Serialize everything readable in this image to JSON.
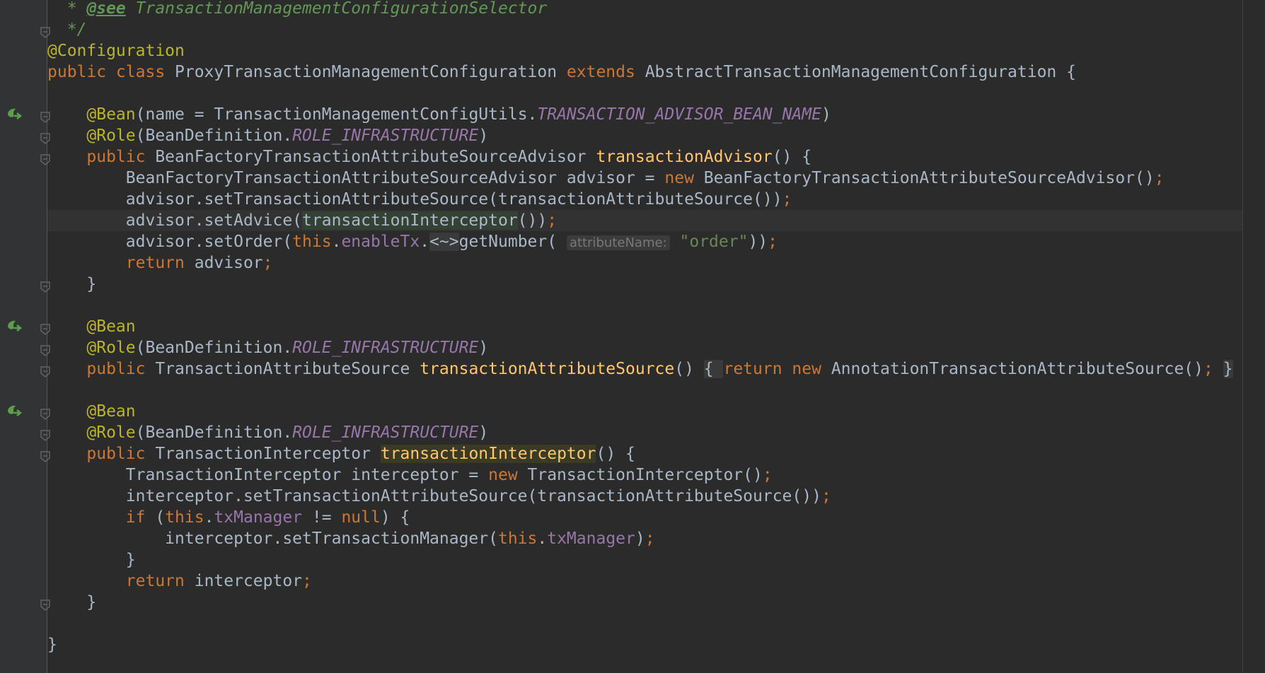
{
  "editor": {
    "lines": [
      {
        "tokens": [
          [
            "cmt",
            "  * "
          ],
          [
            "tagname",
            "@see"
          ],
          [
            "cmt",
            " TransactionManagementConfigurationSelector"
          ]
        ]
      },
      {
        "tokens": [
          [
            "cmt",
            "  */"
          ]
        ]
      },
      {
        "tokens": [
          [
            "ann",
            "@Configuration"
          ]
        ]
      },
      {
        "tokens": [
          [
            "kw",
            "public class "
          ],
          [
            "p",
            "ProxyTransactionManagementConfiguration "
          ],
          [
            "kw",
            "extends "
          ],
          [
            "p",
            "AbstractTransactionManagementConfiguration {"
          ]
        ]
      },
      {
        "tokens": []
      },
      {
        "tokens": [
          [
            "p",
            "    "
          ],
          [
            "ann",
            "@Bean"
          ],
          [
            "p",
            "("
          ],
          [
            "pname",
            "name"
          ],
          [
            "p",
            " = TransactionManagementConfigUtils."
          ],
          [
            "cst",
            "TRANSACTION_ADVISOR_BEAN_NAME"
          ],
          [
            "p",
            ")"
          ]
        ]
      },
      {
        "tokens": [
          [
            "p",
            "    "
          ],
          [
            "ann",
            "@Role"
          ],
          [
            "p",
            "(BeanDefinition."
          ],
          [
            "cst",
            "ROLE_INFRASTRUCTURE"
          ],
          [
            "p",
            ")"
          ]
        ]
      },
      {
        "tokens": [
          [
            "p",
            "    "
          ],
          [
            "kw",
            "public "
          ],
          [
            "p",
            "BeanFactoryTransactionAttributeSourceAdvisor "
          ],
          [
            "mdecl",
            "transactionAdvisor"
          ],
          [
            "p",
            "() {"
          ]
        ]
      },
      {
        "tokens": [
          [
            "p",
            "        BeanFactoryTransactionAttributeSourceAdvisor advisor = "
          ],
          [
            "kw",
            "new "
          ],
          [
            "p",
            "BeanFactoryTransactionAttributeSourceAdvisor()"
          ],
          [
            "semi",
            ";"
          ]
        ]
      },
      {
        "tokens": [
          [
            "p",
            "        advisor.setTransactionAttributeSource(transactionAttributeSource())"
          ],
          [
            "semi",
            ";"
          ]
        ]
      },
      {
        "tokens": [
          [
            "p",
            "        advisor.setAdvice("
          ],
          [
            "usage",
            "transactionInterceptor"
          ],
          [
            "p",
            "())"
          ],
          [
            "semi",
            ";"
          ]
        ],
        "current": true
      },
      {
        "tokens": [
          [
            "p",
            "        advisor.setOrder("
          ],
          [
            "kw",
            "this"
          ],
          [
            "p",
            "."
          ],
          [
            "fld",
            "enableTx"
          ],
          [
            "p",
            "."
          ],
          [
            "fold",
            "<~>"
          ],
          [
            "p",
            "getNumber( "
          ],
          [
            "hint",
            "attributeName:"
          ],
          [
            "p",
            " "
          ],
          [
            "str",
            "\"order\""
          ],
          [
            "p",
            "))"
          ],
          [
            "semi",
            ";"
          ]
        ]
      },
      {
        "tokens": [
          [
            "p",
            "        "
          ],
          [
            "kw",
            "return "
          ],
          [
            "p",
            "advisor"
          ],
          [
            "semi",
            ";"
          ]
        ]
      },
      {
        "tokens": [
          [
            "p",
            "    }"
          ]
        ]
      },
      {
        "tokens": []
      },
      {
        "tokens": [
          [
            "p",
            "    "
          ],
          [
            "ann",
            "@Bean"
          ]
        ]
      },
      {
        "tokens": [
          [
            "p",
            "    "
          ],
          [
            "ann",
            "@Role"
          ],
          [
            "p",
            "(BeanDefinition."
          ],
          [
            "cst",
            "ROLE_INFRASTRUCTURE"
          ],
          [
            "p",
            ")"
          ]
        ]
      },
      {
        "tokens": [
          [
            "p",
            "    "
          ],
          [
            "kw",
            "public "
          ],
          [
            "p",
            "TransactionAttributeSource "
          ],
          [
            "mdecl",
            "transactionAttributeSource"
          ],
          [
            "p",
            "() "
          ],
          [
            "fold",
            "{ "
          ],
          [
            "kw",
            "return new "
          ],
          [
            "p",
            "AnnotationTransactionAttributeSource()"
          ],
          [
            "semi",
            ";"
          ],
          [
            "p",
            " "
          ],
          [
            "fold",
            "}"
          ]
        ]
      },
      {
        "tokens": []
      },
      {
        "tokens": [
          [
            "p",
            "    "
          ],
          [
            "ann",
            "@Bean"
          ]
        ]
      },
      {
        "tokens": [
          [
            "p",
            "    "
          ],
          [
            "ann",
            "@Role"
          ],
          [
            "p",
            "(BeanDefinition."
          ],
          [
            "cst",
            "ROLE_INFRASTRUCTURE"
          ],
          [
            "p",
            ")"
          ]
        ]
      },
      {
        "tokens": [
          [
            "p",
            "    "
          ],
          [
            "kw",
            "public "
          ],
          [
            "p",
            "TransactionInterceptor "
          ],
          [
            "decl",
            "transactionInterceptor"
          ],
          [
            "p",
            "() {"
          ]
        ]
      },
      {
        "tokens": [
          [
            "p",
            "        TransactionInterceptor interceptor = "
          ],
          [
            "kw",
            "new "
          ],
          [
            "p",
            "TransactionInterceptor()"
          ],
          [
            "semi",
            ";"
          ]
        ]
      },
      {
        "tokens": [
          [
            "p",
            "        interceptor.setTransactionAttributeSource(transactionAttributeSource())"
          ],
          [
            "semi",
            ";"
          ]
        ]
      },
      {
        "tokens": [
          [
            "p",
            "        "
          ],
          [
            "kw",
            "if "
          ],
          [
            "p",
            "("
          ],
          [
            "kw",
            "this"
          ],
          [
            "p",
            "."
          ],
          [
            "fld",
            "txManager"
          ],
          [
            "p",
            " != "
          ],
          [
            "kw",
            "null"
          ],
          [
            "p",
            ") {"
          ]
        ]
      },
      {
        "tokens": [
          [
            "p",
            "            interceptor.setTransactionManager("
          ],
          [
            "kw",
            "this"
          ],
          [
            "p",
            "."
          ],
          [
            "fld",
            "txManager"
          ],
          [
            "p",
            ")"
          ],
          [
            "semi",
            ";"
          ]
        ]
      },
      {
        "tokens": [
          [
            "p",
            "        }"
          ]
        ]
      },
      {
        "tokens": [
          [
            "p",
            "        "
          ],
          [
            "kw",
            "return "
          ],
          [
            "p",
            "interceptor"
          ],
          [
            "semi",
            ";"
          ]
        ]
      },
      {
        "tokens": [
          [
            "p",
            "    }"
          ]
        ]
      },
      {
        "tokens": []
      },
      {
        "tokens": [
          [
            "p",
            "}"
          ]
        ]
      }
    ]
  },
  "gutter": {
    "bean_markers": [
      {
        "icon": "bean-override-icon",
        "line": 5
      },
      {
        "icon": "bean-override-icon",
        "line": 15
      },
      {
        "icon": "bean-override-icon",
        "line": 19
      }
    ],
    "fold_markers": [
      1,
      5,
      6,
      7,
      13,
      15,
      16,
      17,
      19,
      20,
      21,
      28
    ]
  },
  "colors": {
    "background": "#2b2b2b",
    "keyword": "#cc7832",
    "annotation": "#bbb529",
    "string": "#6a8759",
    "constant": "#9876aa",
    "method_declaration": "#ffc66d",
    "comment": "#629755"
  }
}
